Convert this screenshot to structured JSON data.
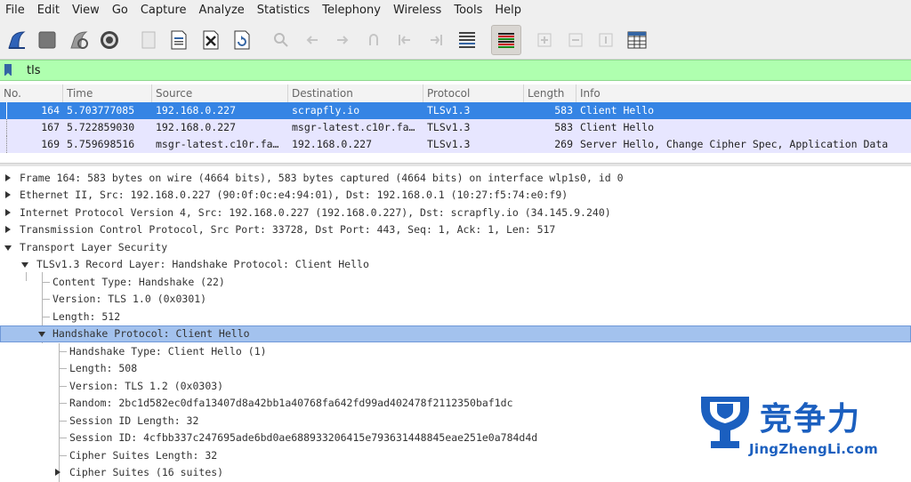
{
  "menu": [
    "File",
    "Edit",
    "View",
    "Go",
    "Capture",
    "Analyze",
    "Statistics",
    "Telephony",
    "Wireless",
    "Tools",
    "Help"
  ],
  "toolbar": {
    "buttons": [
      {
        "icon": "shark-fin-start-icon"
      },
      {
        "icon": "stop-square-icon"
      },
      {
        "icon": "restart-fin-icon"
      },
      {
        "icon": "capture-options-gear-icon"
      },
      {
        "icon": "open-file-icon"
      },
      {
        "icon": "save-file-icon"
      },
      {
        "icon": "close-file-icon"
      },
      {
        "icon": "reload-file-icon"
      },
      {
        "icon": "find-packet-icon"
      },
      {
        "icon": "go-back-icon"
      },
      {
        "icon": "go-forward-icon"
      },
      {
        "icon": "go-to-packet-icon"
      },
      {
        "icon": "first-packet-icon"
      },
      {
        "icon": "last-packet-icon"
      },
      {
        "icon": "auto-scroll-icon"
      },
      {
        "icon": "colorize-icon"
      },
      {
        "icon": "zoom-in-icon"
      },
      {
        "icon": "zoom-out-icon"
      },
      {
        "icon": "normal-size-icon"
      },
      {
        "icon": "resize-columns-icon"
      }
    ]
  },
  "filter": {
    "value": "tls"
  },
  "packet_list": {
    "columns": [
      "No.",
      "Time",
      "Source",
      "Destination",
      "Protocol",
      "Length",
      "Info"
    ],
    "rows": [
      {
        "no": "164",
        "time": "5.703777085",
        "source": "192.168.0.227",
        "destination": "scrapfly.io",
        "protocol": "TLSv1.3",
        "length": "583",
        "info": "Client Hello",
        "selected": true
      },
      {
        "no": "167",
        "time": "5.722859030",
        "source": "192.168.0.227",
        "destination": "msgr-latest.c10r.fa…",
        "protocol": "TLSv1.3",
        "length": "583",
        "info": "Client Hello",
        "selected": false
      },
      {
        "no": "169",
        "time": "5.759698516",
        "source": "msgr-latest.c10r.fa…",
        "destination": "192.168.0.227",
        "protocol": "TLSv1.3",
        "length": "269",
        "info": "Server Hello, Change Cipher Spec, Application Data",
        "selected": false
      }
    ]
  },
  "details": [
    {
      "text": "Frame 164: 583 bytes on wire (4664 bits), 583 bytes captured (4664 bits) on interface wlp1s0, id 0",
      "level": 0,
      "state": "collapsed"
    },
    {
      "text": "Ethernet II, Src: 192.168.0.227 (90:0f:0c:e4:94:01), Dst: 192.168.0.1 (10:27:f5:74:e0:f9)",
      "level": 0,
      "state": "collapsed"
    },
    {
      "text": "Internet Protocol Version 4, Src: 192.168.0.227 (192.168.0.227), Dst: scrapfly.io (34.145.9.240)",
      "level": 0,
      "state": "collapsed"
    },
    {
      "text": "Transmission Control Protocol, Src Port: 33728, Dst Port: 443, Seq: 1, Ack: 1, Len: 517",
      "level": 0,
      "state": "collapsed"
    },
    {
      "text": "Transport Layer Security",
      "level": 0,
      "state": "expanded"
    },
    {
      "text": "TLSv1.3 Record Layer: Handshake Protocol: Client Hello",
      "level": 1,
      "state": "expanded"
    },
    {
      "text": "Content Type: Handshake (22)",
      "level": 2,
      "state": "leaf"
    },
    {
      "text": "Version: TLS 1.0 (0x0301)",
      "level": 2,
      "state": "leaf"
    },
    {
      "text": "Length: 512",
      "level": 2,
      "state": "leaf"
    },
    {
      "text": "Handshake Protocol: Client Hello",
      "level": 2,
      "state": "expanded",
      "selected": true
    },
    {
      "text": "Handshake Type: Client Hello (1)",
      "level": 3,
      "state": "leaf"
    },
    {
      "text": "Length: 508",
      "level": 3,
      "state": "leaf"
    },
    {
      "text": "Version: TLS 1.2 (0x0303)",
      "level": 3,
      "state": "leaf"
    },
    {
      "text": "Random: 2bc1d582ec0dfa13407d8a42bb1a40768fa642fd99ad402478f2112350baf1dc",
      "level": 3,
      "state": "leaf"
    },
    {
      "text": "Session ID Length: 32",
      "level": 3,
      "state": "leaf"
    },
    {
      "text": "Session ID: 4cfbb337c247695ade6bd0ae688933206415e793631448845eae251e0a784d4d",
      "level": 3,
      "state": "leaf"
    },
    {
      "text": "Cipher Suites Length: 32",
      "level": 3,
      "state": "leaf"
    },
    {
      "text": "Cipher Suites (16 suites)",
      "level": 3,
      "state": "collapsed"
    }
  ],
  "watermark": {
    "cn": "竞争力",
    "url": "JingZhengLi.com"
  },
  "colors": {
    "selected_row": "#3584e4",
    "tls_row": "#e7e6ff",
    "filter_bg": "#afffaf",
    "selected_tree": "#a3c2ee",
    "watermark": "#1b5fbf"
  }
}
